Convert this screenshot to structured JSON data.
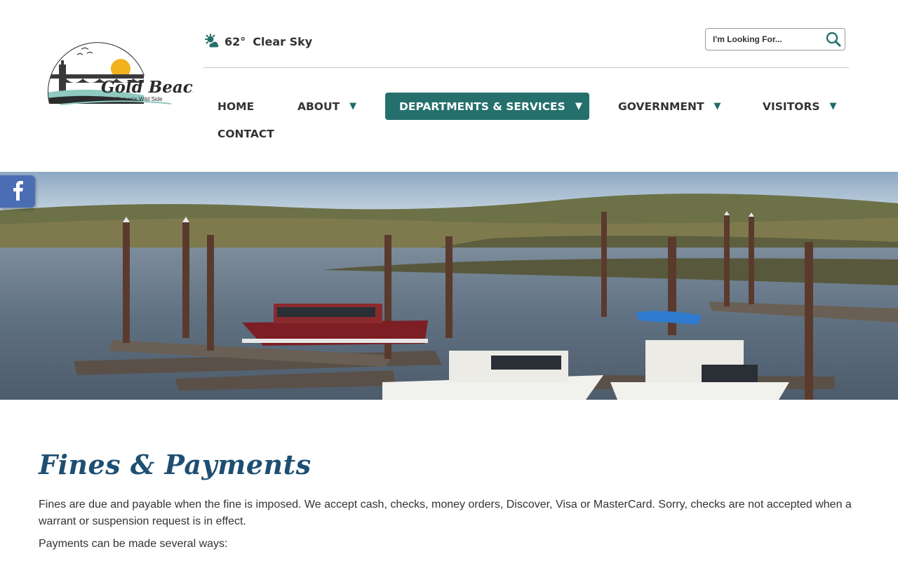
{
  "site": {
    "logo": {
      "name": "Gold Beach",
      "tagline": "Nature's Wild Side"
    }
  },
  "weather": {
    "icon": "partly-sunny-icon",
    "temperature": "62°",
    "condition": "Clear Sky"
  },
  "search": {
    "placeholder": "I'm Looking For...",
    "icon": "search-icon"
  },
  "nav": {
    "items": [
      {
        "label": "HOME",
        "dropdown": false
      },
      {
        "label": "ABOUT",
        "dropdown": true,
        "caret": "▼"
      },
      {
        "label": "DEPARTMENTS & SERVICES",
        "dropdown": true,
        "caret": "▼",
        "active": true
      },
      {
        "label": "GOVERNMENT",
        "dropdown": true,
        "caret": "▼"
      },
      {
        "label": "VISITORS",
        "dropdown": true,
        "caret": "▼"
      },
      {
        "label": "CONTACT",
        "dropdown": false
      }
    ]
  },
  "social": {
    "facebook_icon": "facebook-icon"
  },
  "page": {
    "title": "Fines & Payments",
    "paragraphs": [
      "Fines are due and payable when the fine is imposed. We accept cash, checks, money orders, Discover, Visa or MasterCard.  Sorry, checks are not accepted when a warrant or suspension request is in effect.",
      "Payments can be made several ways:"
    ]
  },
  "colors": {
    "accent_teal": "#25706d",
    "title_blue": "#1e4f72",
    "facebook_blue": "#4a6db3",
    "logo_gold": "#f2b21b"
  }
}
